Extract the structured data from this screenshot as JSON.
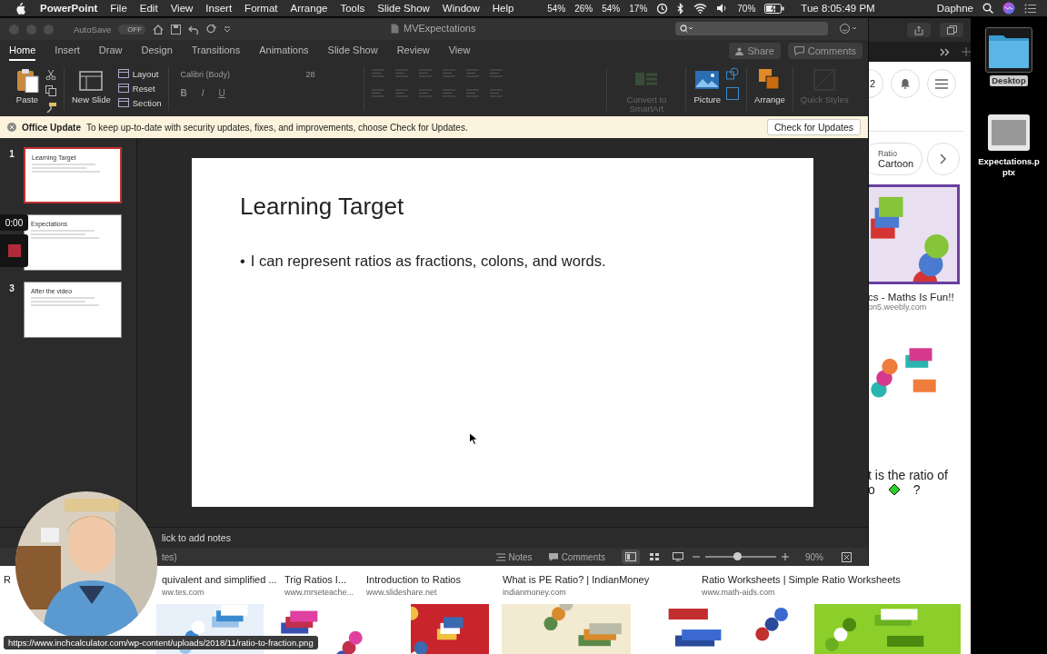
{
  "menu_bar": {
    "app": "PowerPoint",
    "menus": [
      "File",
      "Edit",
      "View",
      "Insert",
      "Format",
      "Arrange",
      "Tools",
      "Slide Show",
      "Window",
      "Help"
    ],
    "meters": [
      "54%",
      "26%",
      "54%",
      "17%"
    ],
    "battery": "70%",
    "clock": "Tue 8:05:49 PM",
    "user": "Daphne"
  },
  "browser": {
    "header_badge": "2",
    "chip": {
      "label": "Ratio",
      "value": "Cartoon"
    },
    "featured": {
      "title": "cs - Maths Is Fun!!",
      "source": "on5.weebly.com"
    },
    "question": {
      "line1": "t is the ratio of",
      "line2_start": "o",
      "line2_end": "?"
    },
    "results": [
      {
        "title": "R"
      },
      {
        "title": "quivalent and simplified ...",
        "source": "ww.tes.com"
      },
      {
        "title": "Trig Ratios I...",
        "source": "www.mrseteache..."
      },
      {
        "title": "Introduction to Ratios",
        "source": "www.slideshare.net"
      },
      {
        "title": "What is PE Ratio? | IndianMoney",
        "source": "indianmoney.com"
      },
      {
        "title": "Ratio Worksheets | Simple Ratio Worksheets",
        "source": "www.math-aids.com"
      }
    ]
  },
  "powerpoint": {
    "autosave": {
      "label": "AutoSave",
      "state": "OFF"
    },
    "title": "MVExpectations",
    "tabs": [
      {
        "label": "Home",
        "selected": true
      },
      {
        "label": "Insert",
        "selected": false
      },
      {
        "label": "Draw",
        "selected": false
      },
      {
        "label": "Design",
        "selected": false
      },
      {
        "label": "Transitions",
        "selected": false
      },
      {
        "label": "Animations",
        "selected": false
      },
      {
        "label": "Slide Show",
        "selected": false
      },
      {
        "label": "Review",
        "selected": false
      },
      {
        "label": "View",
        "selected": false
      }
    ],
    "share": "Share",
    "comments": "Comments",
    "ribbon": [
      {
        "kind": "paste",
        "label": "Paste",
        "disabled": false
      },
      {
        "kind": "new-slide",
        "label": "New Slide",
        "disabled": false
      },
      {
        "kind": "stack",
        "items": [
          "Layout",
          "Reset",
          "Section"
        ]
      },
      {
        "kind": "font",
        "font": "Calibri (Body)",
        "size": "28",
        "buttons": [
          "B",
          "I",
          "U"
        ],
        "disabled": true
      },
      {
        "kind": "paragraph",
        "disabled": true
      },
      {
        "kind": "smartart",
        "label": "Convert to SmartArt",
        "disabled": true
      },
      {
        "kind": "picture",
        "label": "Picture",
        "disabled": false
      },
      {
        "kind": "arrange",
        "label": "Arrange",
        "disabled": false
      },
      {
        "kind": "styles",
        "label": "Quick Styles",
        "disabled": true
      }
    ],
    "update_bar": {
      "title": "Office Update",
      "message": "To keep up-to-date with security updates, fixes, and improvements, choose Check for Updates.",
      "button": "Check for Updates"
    },
    "slides": [
      {
        "number": "1",
        "title": "Learning Target",
        "selected": true
      },
      {
        "title": "Expectations",
        "selected": false
      },
      {
        "number": "3",
        "title": "After the video",
        "selected": false
      }
    ],
    "recording": {
      "time": "0:00"
    },
    "slide": {
      "title": "Learning Target",
      "bullets": [
        {
          "mark": "•",
          "text": "I can represent ratios as fractions, colons, and words."
        }
      ]
    },
    "notes_placeholder": "lick to add notes",
    "status_bar": {
      "language": "tes)",
      "notes": "Notes",
      "comments": "Comments",
      "zoom": {
        "level": 0.45,
        "reading": "90%"
      }
    }
  },
  "desktop_icons": [
    {
      "kind": "folder",
      "label": "Desktop",
      "selected": true
    },
    {
      "kind": "document",
      "label": "Expectations.pptx",
      "selected": false
    }
  ],
  "link_preview": "https://www.inchcalculator.com/wp-content/uploads/2018/11/ratio-to-fraction.png"
}
